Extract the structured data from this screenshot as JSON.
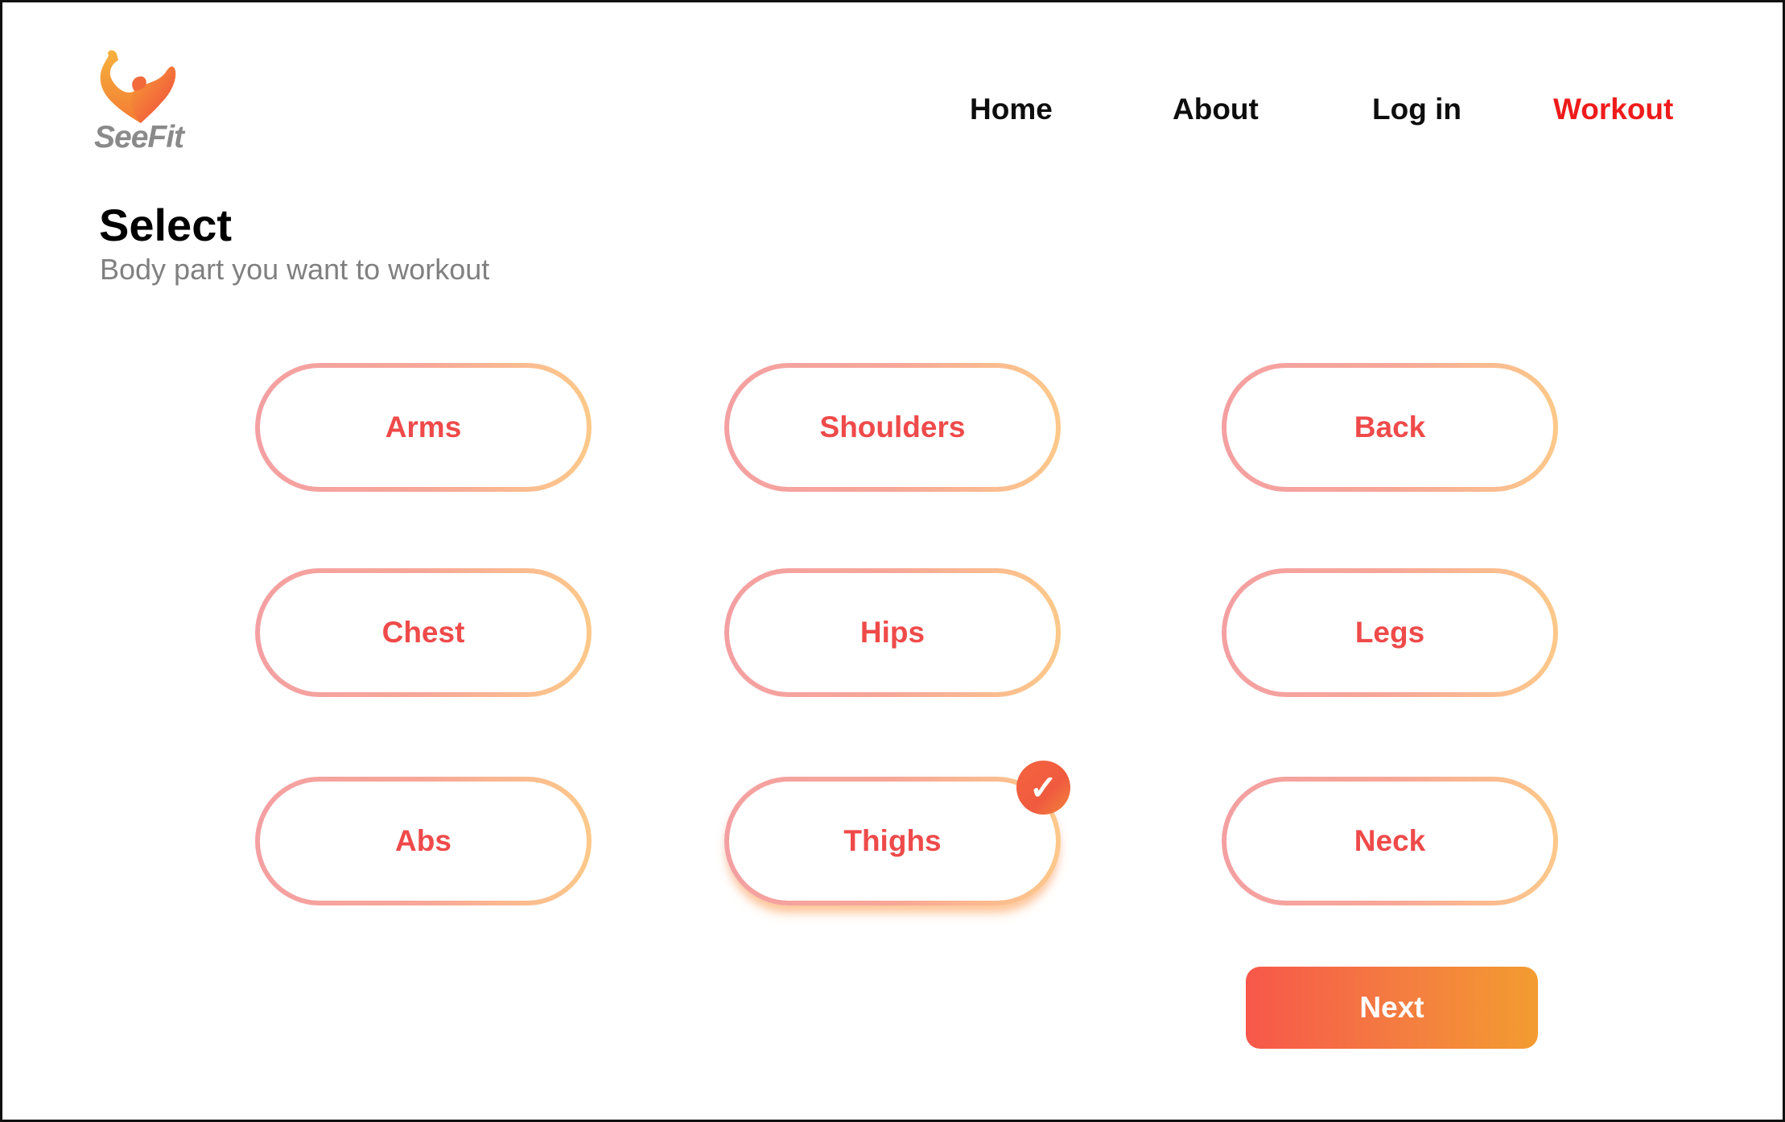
{
  "brand": {
    "name": "SeeFit"
  },
  "nav": {
    "items": [
      {
        "label": "Home",
        "active": false
      },
      {
        "label": "About",
        "active": false
      },
      {
        "label": "Log in",
        "active": false
      },
      {
        "label": "Workout",
        "active": true
      }
    ],
    "active_color": "#ef1b1b"
  },
  "page": {
    "title": "Select",
    "subtitle": "Body part you want to workout"
  },
  "options": [
    {
      "label": "Arms",
      "selected": false
    },
    {
      "label": "Shoulders",
      "selected": false
    },
    {
      "label": "Back",
      "selected": false
    },
    {
      "label": "Chest",
      "selected": false
    },
    {
      "label": "Hips",
      "selected": false
    },
    {
      "label": "Legs",
      "selected": false
    },
    {
      "label": "Abs",
      "selected": false
    },
    {
      "label": "Thighs",
      "selected": true
    },
    {
      "label": "Neck",
      "selected": false
    }
  ],
  "selected_icon": {
    "name": "check-icon",
    "glyph": "✓"
  },
  "next_button": {
    "label": "Next"
  },
  "colors": {
    "option_text": "#ef4a4a",
    "gradient_start": "#f7574a",
    "gradient_end": "#f39c30"
  }
}
